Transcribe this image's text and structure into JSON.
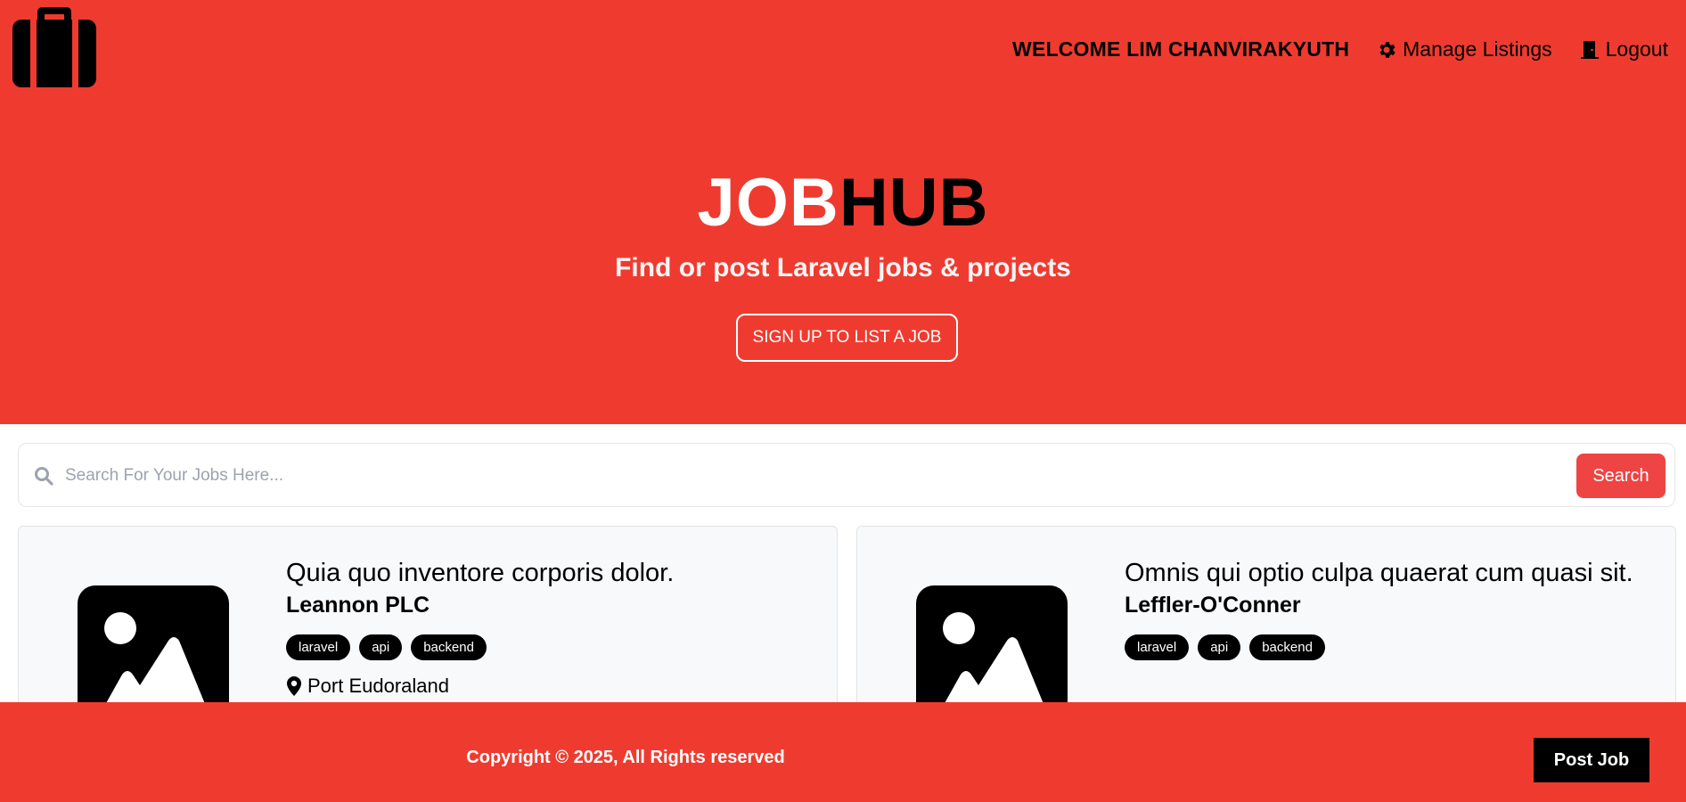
{
  "header": {
    "logo_icon": "briefcase-icon",
    "welcome_text": "WELCOME LIM CHANVIRAKYUTH",
    "manage_label": "Manage Listings",
    "manage_icon": "gear-icon",
    "logout_label": "Logout",
    "logout_icon": "door-icon"
  },
  "hero": {
    "brand_part1": "JOB",
    "brand_part2": "HUB",
    "tagline": "Find or post Laravel jobs & projects",
    "signup_label": "SIGN UP TO LIST A JOB"
  },
  "search": {
    "placeholder": "Search For Your Jobs Here...",
    "button_label": "Search",
    "icon": "search-icon"
  },
  "listings": [
    {
      "title": "Quia quo inventore corporis dolor.",
      "company": "Leannon PLC",
      "tags": [
        "laravel",
        "api",
        "backend"
      ],
      "location": "Port Eudoraland"
    },
    {
      "title": "Omnis qui optio culpa quaerat cum quasi sit.",
      "company": "Leffler-O'Conner",
      "tags": [
        "laravel",
        "api",
        "backend"
      ]
    }
  ],
  "footer": {
    "copyright": "Copyright © 2025, All Rights reserved",
    "post_label": "Post Job"
  },
  "colors": {
    "primary_red": "#ef3b2f",
    "button_red": "#ef4444",
    "black": "#000000",
    "card_bg": "#f8f9fb"
  }
}
